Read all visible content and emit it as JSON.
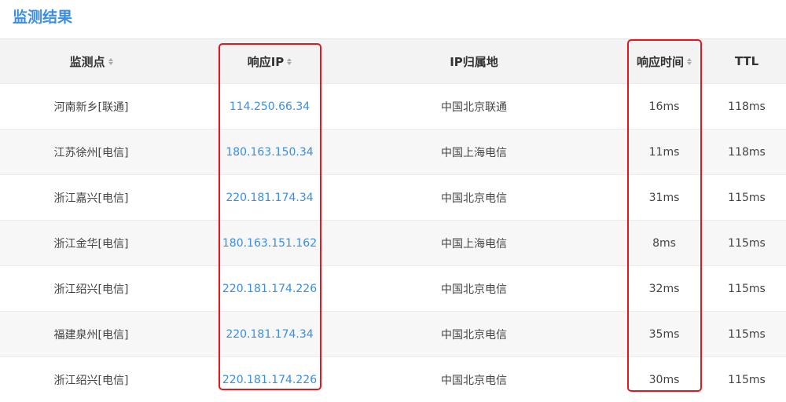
{
  "section_title": "监测结果",
  "columns": [
    {
      "label": "监测点",
      "sortable": true
    },
    {
      "label": "响应IP",
      "sortable": true
    },
    {
      "label": "IP归属地",
      "sortable": false
    },
    {
      "label": "响应时间",
      "sortable": true
    },
    {
      "label": "TTL",
      "sortable": false
    }
  ],
  "rows": [
    {
      "location": "河南新乡[联通]",
      "ip": "114.250.66.34",
      "ip_region": "中国北京联通",
      "response_time": "16ms",
      "ttl": "118ms"
    },
    {
      "location": "江苏徐州[电信]",
      "ip": "180.163.150.34",
      "ip_region": "中国上海电信",
      "response_time": "11ms",
      "ttl": "118ms"
    },
    {
      "location": "浙江嘉兴[电信]",
      "ip": "220.181.174.34",
      "ip_region": "中国北京电信",
      "response_time": "31ms",
      "ttl": "115ms"
    },
    {
      "location": "浙江金华[电信]",
      "ip": "180.163.151.162",
      "ip_region": "中国上海电信",
      "response_time": "8ms",
      "ttl": "115ms"
    },
    {
      "location": "浙江绍兴[电信]",
      "ip": "220.181.174.226",
      "ip_region": "中国北京电信",
      "response_time": "32ms",
      "ttl": "115ms"
    },
    {
      "location": "福建泉州[电信]",
      "ip": "220.181.174.34",
      "ip_region": "中国北京电信",
      "response_time": "35ms",
      "ttl": "115ms"
    },
    {
      "location": "浙江绍兴[电信]",
      "ip": "220.181.174.226",
      "ip_region": "中国北京电信",
      "response_time": "30ms",
      "ttl": "115ms"
    }
  ],
  "colors": {
    "title": "#3a8ee6",
    "ip_link": "#3a8ee6",
    "highlight_box": "#e8161c",
    "header_bg": "#f3f3f3",
    "alt_row_bg": "#f7f7f7"
  }
}
